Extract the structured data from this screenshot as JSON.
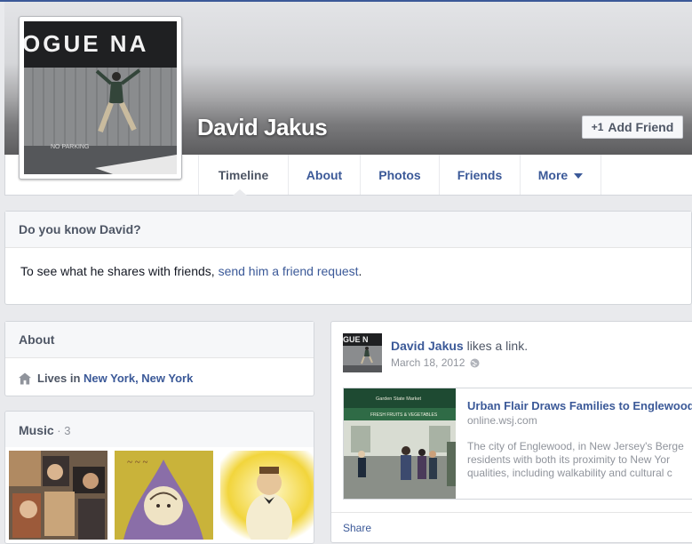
{
  "profile": {
    "name": "David Jakus",
    "add_friend_label": "Add Friend",
    "cover_sign_text": "OGUE NA",
    "photo_ground_text": "NO PARKING"
  },
  "nav": {
    "items": [
      {
        "label": "Timeline",
        "active": true
      },
      {
        "label": "About"
      },
      {
        "label": "Photos"
      },
      {
        "label": "Friends"
      },
      {
        "label": "More"
      }
    ]
  },
  "know": {
    "title": "Do you know David?",
    "text_prefix": "To see what he shares with friends, ",
    "link_text": "send him a friend request",
    "text_suffix": "."
  },
  "about": {
    "title": "About",
    "lives_prefix": "Lives in ",
    "location": "New York, New York"
  },
  "music": {
    "title": "Music",
    "count": " · 3"
  },
  "post": {
    "author": "David Jakus",
    "action": " likes a link.",
    "date": "March 18, 2012",
    "thumb_text": "GUE N",
    "link": {
      "title": "Urban Flair Draws Families to Englewood",
      "domain": "online.wsj.com",
      "description": "The city of Englewood, in New Jersey's Berge\nresidents with both its proximity to New Yor\nqualities, including walkability and cultural c",
      "sign_text": "Garden State Market",
      "banner_text": "FRESH FRUITS & VEGETABLES"
    },
    "share_label": "Share"
  },
  "colors": {
    "brand": "#3b5998",
    "background": "#e9eaed",
    "muted": "#90949c"
  }
}
